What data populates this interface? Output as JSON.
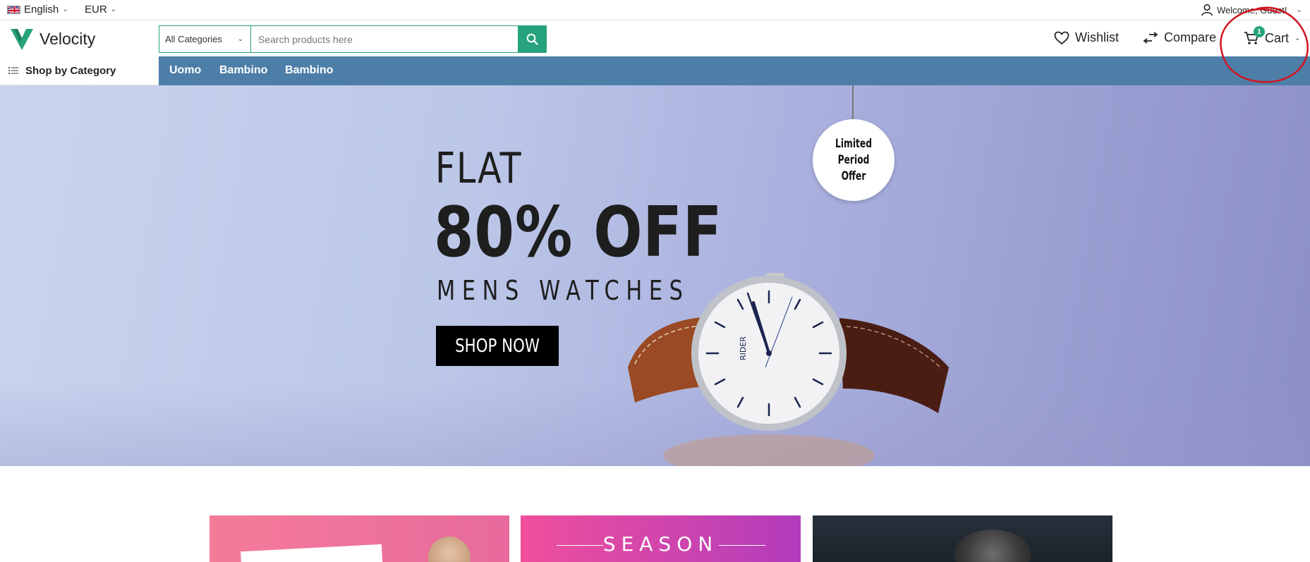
{
  "topbar": {
    "language": "English",
    "currency": "EUR",
    "welcome": "Welcome, Guest!"
  },
  "header": {
    "logo_text": "Velocity",
    "category_select": "All Categories",
    "search_placeholder": "Search products here",
    "wishlist_label": "Wishlist",
    "compare_label": "Compare",
    "cart_label": "Cart",
    "cart_count": "1"
  },
  "nav": {
    "shop_by_category": "Shop by Category",
    "items": [
      "Uomo",
      "Bambino",
      "Bambino"
    ]
  },
  "hero": {
    "line1": "FLAT",
    "line2": "80% OFF",
    "line3": "MENS WATCHES",
    "button": "SHOP NOW",
    "tag_line1": "Limited",
    "tag_line2": "Period",
    "tag_line3": "Offer",
    "watch_brand": "RIDER"
  },
  "promos": {
    "card2_title": "SEASON"
  },
  "colors": {
    "accent": "#26a37c",
    "navbar": "#4d7ea8",
    "annotation": "#d0151f"
  }
}
